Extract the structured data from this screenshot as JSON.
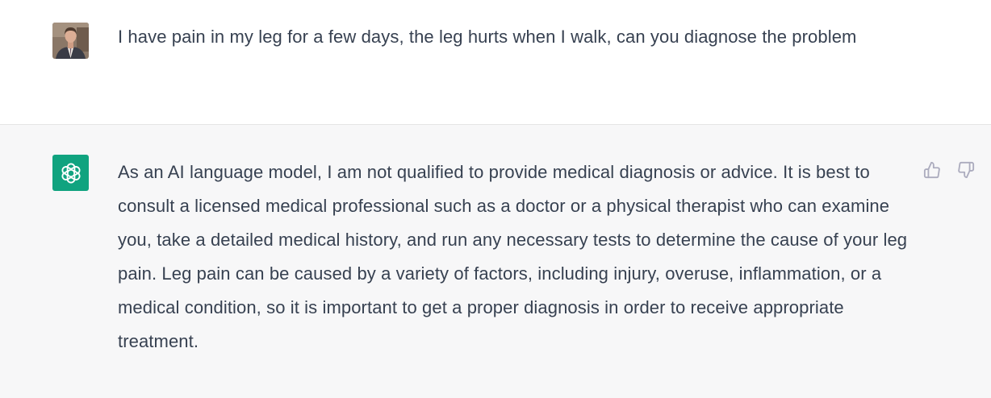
{
  "conversation": {
    "user_message": {
      "text": "I have pain in my leg for a few days, the leg hurts when I walk, can you diagnose the problem"
    },
    "assistant_message": {
      "text": "As an AI language model, I am not qualified to provide medical diagnosis or advice. It is best to consult a licensed medical professional such as a doctor or a physical therapist who can examine you, take a detailed medical history, and run any necessary tests to determine the cause of your leg pain. Leg pain can be caused by a variety of factors, including injury, overuse, inflammation, or a medical condition, so it is important to get a proper diagnosis in order to receive appropriate treatment."
    }
  },
  "icons": {
    "user_avatar": "user-avatar-photo",
    "assistant_avatar": "openai-logo-icon",
    "thumbs_up": "thumbs-up-icon",
    "thumbs_down": "thumbs-down-icon"
  },
  "colors": {
    "assistant_brand": "#10a37f",
    "assistant_background": "#f7f7f8",
    "user_background": "#ffffff",
    "text": "#374151",
    "icon": "#acacbe"
  }
}
